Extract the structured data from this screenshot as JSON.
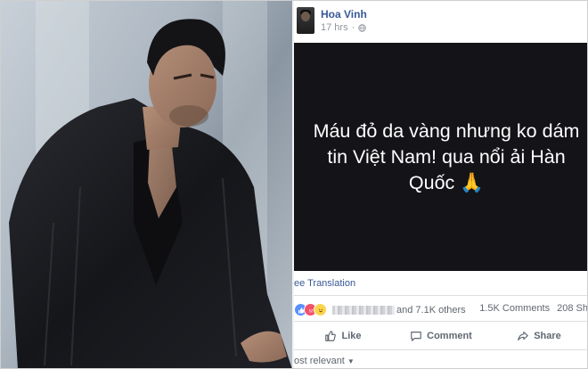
{
  "post": {
    "author": "Hoa Vinh",
    "time": "17 hrs",
    "text": "Máu đỏ da vàng nhưng ko dám tin Việt Nam! qua nổi ải Hàn Quốc 🙏",
    "see_translation": "ee Translation"
  },
  "reactions": {
    "others": "and 7.1K others"
  },
  "counts": {
    "comments": "1.5K Comments",
    "shares": "208 Sh"
  },
  "actions": {
    "like": "Like",
    "comment": "Comment",
    "share": "Share"
  },
  "sort": {
    "label": "ost relevant"
  },
  "colors": {
    "link_blue": "#385898",
    "post_background": "#131318",
    "muted_gray": "#606770"
  }
}
